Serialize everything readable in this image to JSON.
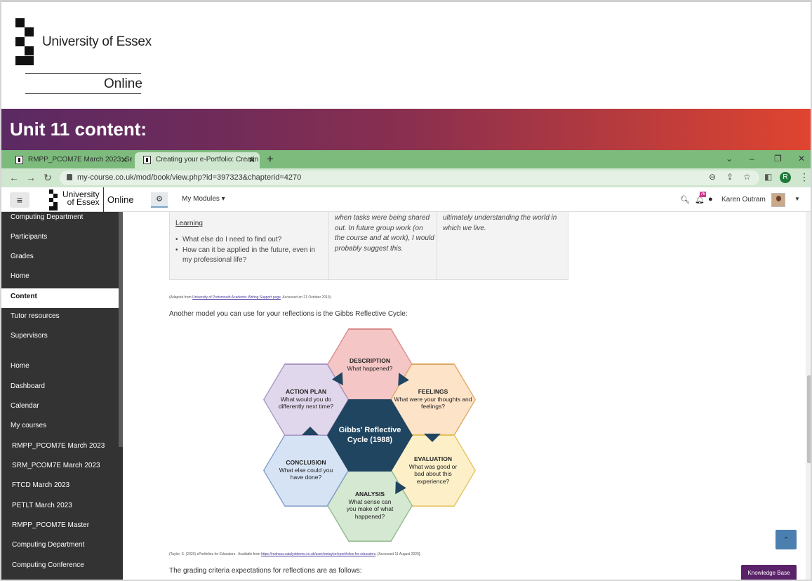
{
  "slide": {
    "logo_name": "University of Essex",
    "logo_sub": "Online",
    "banner_title": "Unit 11 content:"
  },
  "browser": {
    "tabs": [
      {
        "label": "RMPP_PCOM7E March 2023: Sem"
      },
      {
        "label": "Creating your e-Portfolio: Creatin"
      }
    ],
    "new_tab": "+",
    "window_controls": [
      "⌄",
      "–",
      "❐",
      "✕"
    ],
    "url": "my-course.co.uk/mod/book/view.php?id=397323&chapterid=4270",
    "profile_initial": "R"
  },
  "topnav": {
    "hamburger": "≡",
    "brand_line1": "University",
    "brand_line2": "of Essex",
    "online": "Online",
    "my_modules": "My Modules ▾",
    "notif_badge": "76",
    "user_name": "Karen Outram"
  },
  "sidebar": {
    "items": [
      {
        "label": "Computing Department"
      },
      {
        "label": "Participants"
      },
      {
        "label": "Grades"
      },
      {
        "label": "Home"
      },
      {
        "label": "Content"
      },
      {
        "label": "Tutor resources"
      },
      {
        "label": "Supervisors"
      },
      {
        "label": "Home"
      },
      {
        "label": "Dashboard"
      },
      {
        "label": "Calendar"
      },
      {
        "label": "My courses"
      },
      {
        "label": "RMPP_PCOM7E March 2023"
      },
      {
        "label": "SRM_PCOM7E March 2023"
      },
      {
        "label": "FTCD March 2023"
      },
      {
        "label": "PETLT March 2023"
      },
      {
        "label": "RMPP_PCOM7E Master"
      },
      {
        "label": "Computing Department"
      },
      {
        "label": "Computing Conference"
      }
    ]
  },
  "table": {
    "heading": "Learning",
    "bullets": [
      "What else do I need to find out?",
      "How can it be applied in the future, even in my professional life?"
    ],
    "col2_text": "when tasks were being shared out. In future group work (on the course and at work), I would probably suggest this.",
    "col3_text": "ultimately understanding the world in which we live."
  },
  "content": {
    "cite1_prefix": "(Adapted from",
    "cite1_link": "University of Portsmouth Academic Writing Support page",
    "cite1_suffix": ", Accessed on 21 October 2019).",
    "intro": "Another model you can use for your reflections is the Gibbs Reflective Cycle:",
    "cite2_prefix": "(Taylor, S. (2020) ePortfolios for Educators . Available from",
    "cite2_link": "https://mahara.catalystdemo.co.uk/user/smtaylor/eportfolios-for-educators",
    "cite2_suffix": ". [Accessed 11 August 2020].",
    "grading": "The grading criteria expectations for reflections are as follows:"
  },
  "gibbs": {
    "center": "Gibbs' Reflective Cycle (1988)",
    "description": {
      "title": "DESCRIPTION",
      "text": "What happened?",
      "color": "#f5c6c6",
      "border": "#d98a8a"
    },
    "feelings": {
      "title": "FEELINGS",
      "text": "What were your thoughts and feelings?",
      "color": "#fde3c8",
      "border": "#e0a762"
    },
    "evaluation": {
      "title": "EVALUATION",
      "text": "What was good or bad about this experience?",
      "color": "#fdf0c8",
      "border": "#e3c15a"
    },
    "analysis": {
      "title": "ANALYSIS",
      "text": "What sense can you make of what happened?",
      "color": "#d5e8d2",
      "border": "#8fb98a"
    },
    "conclusion": {
      "title": "CONCLUSION",
      "text": "What else could you have done?",
      "color": "#d6e3f5",
      "border": "#7f9bc8"
    },
    "action_plan": {
      "title": "ACTION PLAN",
      "text": "What would you do differently next time?",
      "color": "#e1d7ec",
      "border": "#a795c2"
    },
    "center_color": "#1f4560"
  },
  "buttons": {
    "back_to_top": "⌃",
    "knowledge_base": "Knowledge Base"
  }
}
